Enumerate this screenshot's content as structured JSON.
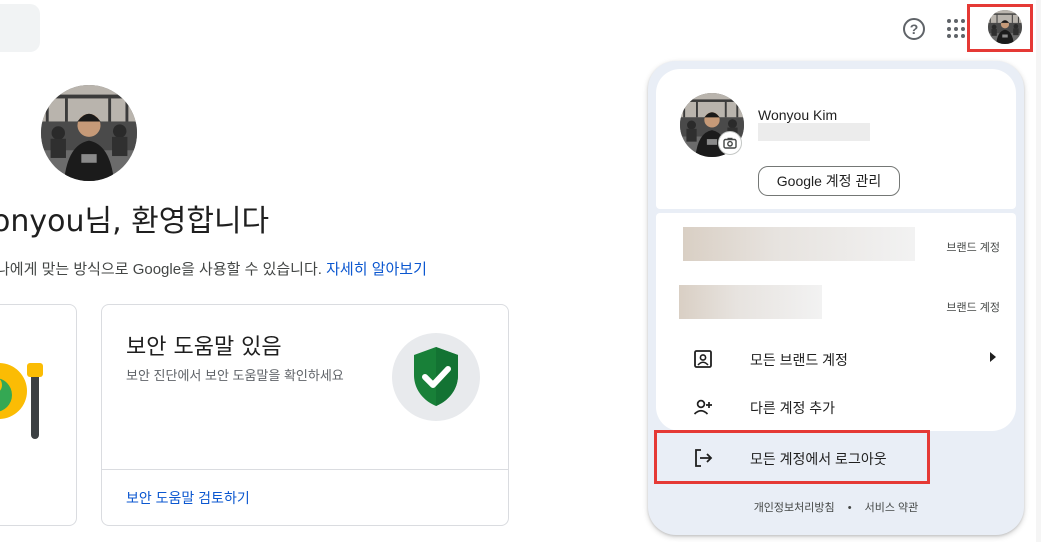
{
  "header": {
    "help_icon": "help-circle-icon",
    "apps_icon": "apps-grid-icon",
    "avatar_icon": "account-avatar"
  },
  "main": {
    "welcome": "onyou님, 환영합니다",
    "subtitle_text": "나에게 맞는 방식으로 Google을 사용할 수 있습니다.",
    "subtitle_link": "자세히 알아보기",
    "security_card": {
      "title": "보안 도움말 있음",
      "description": "보안 진단에서 보안 도움말을 확인하세요",
      "action": "보안 도움말 검토하기"
    }
  },
  "account_menu": {
    "name": "Wonyou Kim",
    "manage_button": "Google 계정 관리",
    "brand_accounts": [
      {
        "label": "브랜드 계정"
      },
      {
        "label": "브랜드 계정"
      }
    ],
    "items": [
      {
        "label": "모든 브랜드 계정",
        "icon": "account-box-icon"
      },
      {
        "label": "다른 계정 추가",
        "icon": "person-add-icon"
      }
    ],
    "sign_out": "모든 계정에서 로그아웃",
    "footer": {
      "privacy": "개인정보처리방침",
      "separator": "•",
      "terms": "서비스 약관"
    }
  },
  "colors": {
    "highlight": "#e53935",
    "link": "#0b57d0",
    "menu_bg": "#e9eef6",
    "shield_green": "#188038"
  }
}
